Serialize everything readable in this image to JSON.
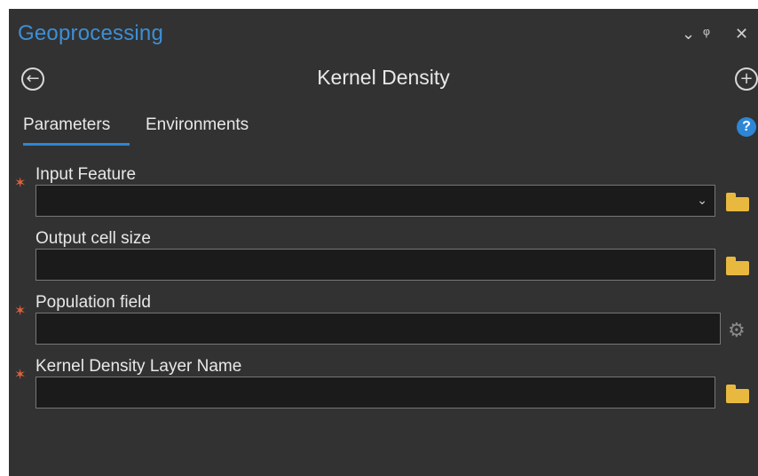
{
  "pane": {
    "title": "Geoprocessing",
    "controls": {
      "dropdown": "⌄",
      "pin": "ᵠ",
      "close": "✕"
    }
  },
  "tool": {
    "title": "Kernel Density",
    "back_icon": "←",
    "add_icon": "+"
  },
  "tabs": [
    {
      "label": "Parameters",
      "active": true
    },
    {
      "label": "Environments",
      "active": false
    }
  ],
  "help_icon": "?",
  "parameters": [
    {
      "label": "Input Feature",
      "required": true,
      "value": "",
      "has_dropdown": true,
      "side_icon": "folder-icon"
    },
    {
      "label": "Output cell size",
      "required": false,
      "value": "",
      "has_dropdown": false,
      "side_icon": "folder-icon"
    },
    {
      "label": "Population field",
      "required": true,
      "value": "",
      "has_dropdown": false,
      "side_icon": "gear-icon"
    },
    {
      "label": "Kernel Density Layer Name",
      "required": true,
      "value": "",
      "has_dropdown": false,
      "side_icon": "folder-icon"
    }
  ],
  "required_marker": "✶",
  "colors": {
    "panel_bg": "#323232",
    "title_blue": "#3d8fd6",
    "accent_blue": "#2e86d6",
    "required_orange": "#e0603d",
    "folder_yellow": "#e9b93f"
  }
}
